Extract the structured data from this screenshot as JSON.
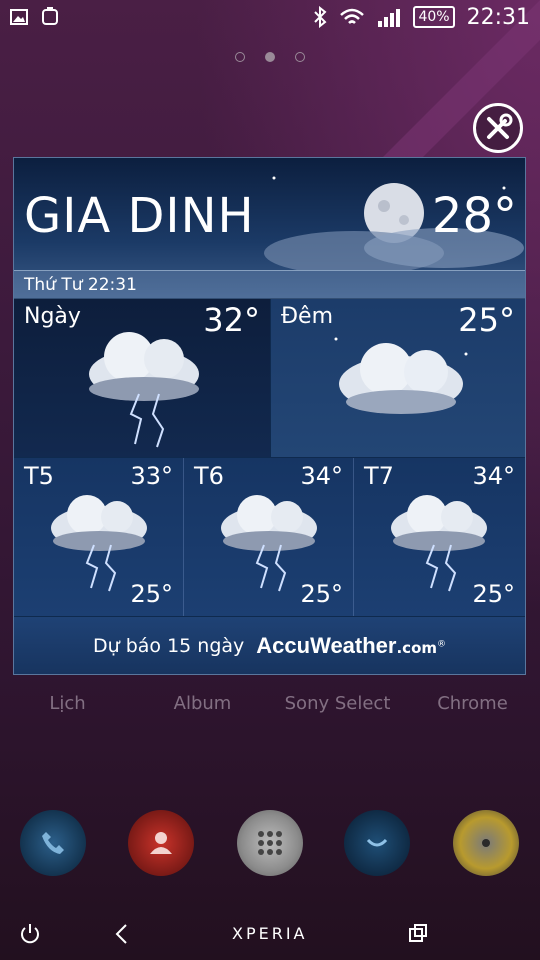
{
  "status_bar": {
    "battery": "40%",
    "time": "22:31"
  },
  "widget": {
    "city": "GIA DINH",
    "current_temp": "28°",
    "date_time": "Thứ Tư 22:31",
    "day": {
      "label": "Ngày",
      "temp": "32°"
    },
    "night": {
      "label": "Đêm",
      "temp": "25°"
    },
    "forecast": [
      {
        "day": "T5",
        "high": "33°",
        "low": "25°"
      },
      {
        "day": "T6",
        "high": "34°",
        "low": "25°"
      },
      {
        "day": "T7",
        "high": "34°",
        "low": "25°"
      }
    ],
    "footer_link": "Dự báo 15 ngày",
    "brand_main": "AccuWeather",
    "brand_suffix": ".com",
    "brand_mark": "®"
  },
  "apps": [
    "Lịch",
    "Album",
    "Sony Select",
    "Chrome"
  ],
  "dock": [
    "phone",
    "contacts",
    "app-drawer",
    "messaging",
    "music"
  ],
  "nav_bar": {
    "brand": "XPERIA"
  },
  "colors": {
    "background": "#3c1a3c",
    "widget": "#0f2a4e"
  }
}
